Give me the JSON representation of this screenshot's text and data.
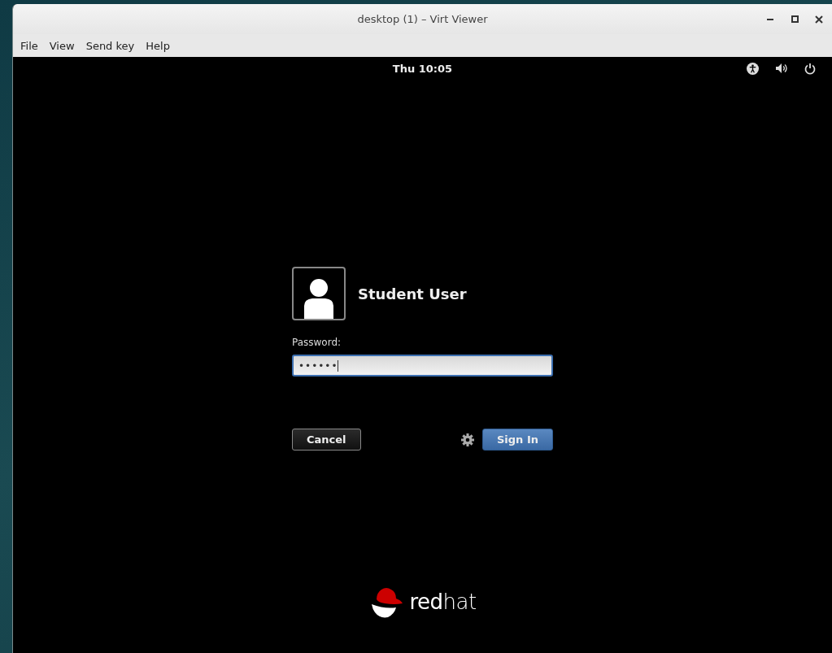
{
  "window": {
    "title": "desktop (1) – Virt Viewer"
  },
  "menu": [
    "File",
    "View",
    "Send key",
    "Help"
  ],
  "top_bar": {
    "clock": "Thu 10:05"
  },
  "login": {
    "user_name": "Student User",
    "password_label": "Password:",
    "password_value": "••••••",
    "focused": true,
    "buttons": [
      {
        "label": "Cancel",
        "kind": "secondary"
      },
      {
        "label": "Sign In",
        "kind": "primary"
      }
    ]
  },
  "logo": {
    "text": "**red**hat"
  }
}
